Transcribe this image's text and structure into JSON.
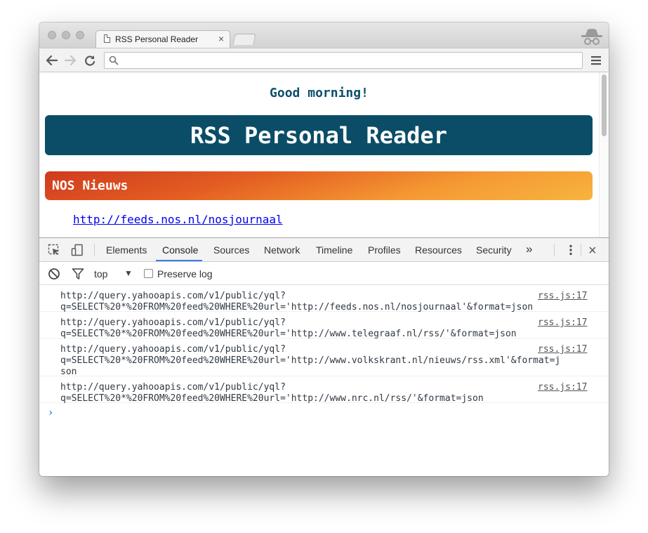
{
  "browser": {
    "tab_title": "RSS Personal Reader",
    "tab_close": "×",
    "address": ""
  },
  "page": {
    "greeting": "Good morning!",
    "title": "RSS Personal Reader",
    "feed_title": "NOS Nieuws",
    "feed_link": "http://feeds.nos.nl/nosjournaal",
    "colors": {
      "header_bg": "#0b4d66",
      "greeting": "#0d4f68",
      "feed_gradient_start": "#cf3a1e",
      "feed_gradient_end": "#f7b43f",
      "link": "#0000ee"
    }
  },
  "devtools": {
    "tabs": [
      "Elements",
      "Console",
      "Sources",
      "Network",
      "Timeline",
      "Profiles",
      "Resources",
      "Security"
    ],
    "active_tab": "Console",
    "more": "»",
    "close": "×",
    "context": "top",
    "context_arrow": "▼",
    "preserve_log": "Preserve log",
    "preserve_checked": false,
    "prompt": "›",
    "messages": [
      {
        "text": "http://query.yahooapis.com/v1/public/yql?\nq=SELECT%20*%20FROM%20feed%20WHERE%20url='http://feeds.nos.nl/nosjournaal'&format=json",
        "source": "rss.js:17"
      },
      {
        "text": "http://query.yahooapis.com/v1/public/yql?\nq=SELECT%20*%20FROM%20feed%20WHERE%20url='http://www.telegraaf.nl/rss/'&format=json",
        "source": "rss.js:17"
      },
      {
        "text": "http://query.yahooapis.com/v1/public/yql?\nq=SELECT%20*%20FROM%20feed%20WHERE%20url='http://www.volkskrant.nl/nieuws/rss.xml'&format=j\nson",
        "source": "rss.js:17"
      },
      {
        "text": "http://query.yahooapis.com/v1/public/yql?\nq=SELECT%20*%20FROM%20feed%20WHERE%20url='http://www.nrc.nl/rss/'&format=json",
        "source": "rss.js:17"
      }
    ]
  }
}
